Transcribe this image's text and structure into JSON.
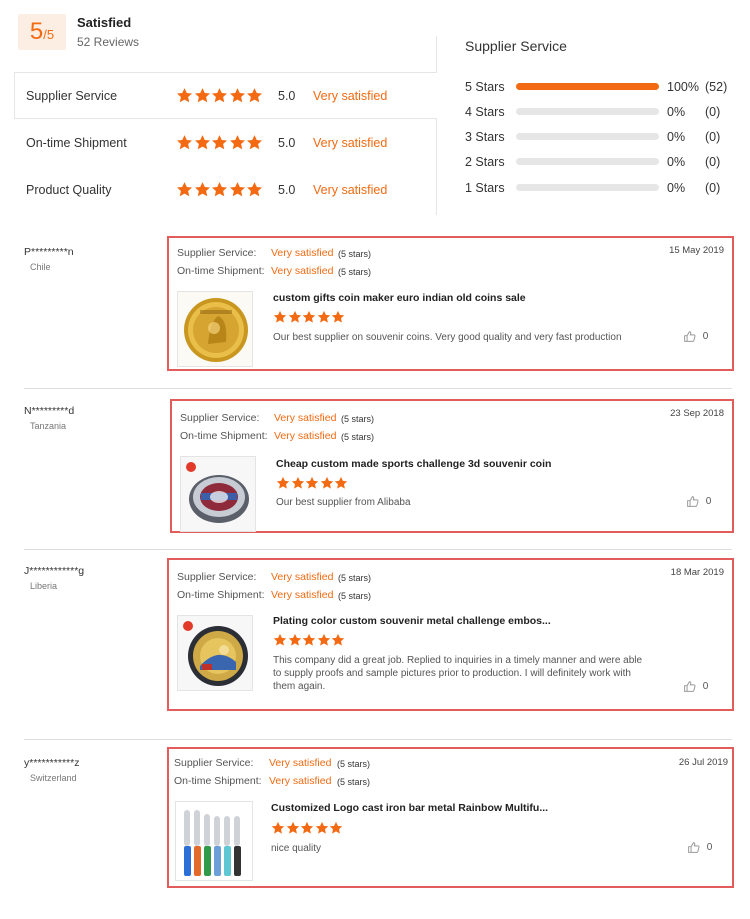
{
  "summary": {
    "score": "5",
    "score_suffix": "/5",
    "title": "Satisfied",
    "review_count": "52 Reviews",
    "metrics": [
      {
        "name": "Supplier Service",
        "score": "5.0",
        "verdict": "Very satisfied",
        "stars": 5
      },
      {
        "name": "On-time Shipment",
        "score": "5.0",
        "verdict": "Very satisfied",
        "stars": 5
      },
      {
        "name": "Product Quality",
        "score": "5.0",
        "verdict": "Very satisfied",
        "stars": 5
      }
    ]
  },
  "distribution": {
    "title": "Supplier Service",
    "rows": [
      {
        "label": "5 Stars",
        "fraction": 1.0,
        "pct": "100%",
        "count": "(52)"
      },
      {
        "label": "4 Stars",
        "fraction": 0.0,
        "pct": "0%",
        "count": "(0)"
      },
      {
        "label": "3 Stars",
        "fraction": 0.0,
        "pct": "0%",
        "count": "(0)"
      },
      {
        "label": "2 Stars",
        "fraction": 0.0,
        "pct": "0%",
        "count": "(0)"
      },
      {
        "label": "1 Stars",
        "fraction": 0.0,
        "pct": "0%",
        "count": "(0)"
      }
    ]
  },
  "reviews": [
    {
      "reviewer": "P*********n",
      "country": "Chile",
      "service_label": "Supplier Service:",
      "service_verdict": "Very satisfied",
      "service_stars": "(5 stars)",
      "shipment_label": "On-time Shipment:",
      "shipment_verdict": "Very satisfied",
      "shipment_stars": "(5 stars)",
      "date": "15 May 2019",
      "product_title": "custom gifts coin maker euro indian old coins sale",
      "rating": 5,
      "comment": "Our best supplier on souvenir coins. Very good quality and very fast production",
      "likes": "0",
      "thumb": "gold-coin-image"
    },
    {
      "reviewer": "N*********d",
      "country": "Tanzania",
      "service_label": "Supplier Service:",
      "service_verdict": "Very satisfied",
      "service_stars": "(5 stars)",
      "shipment_label": "On-time Shipment:",
      "shipment_verdict": "Very satisfied",
      "shipment_stars": "(5 stars)",
      "date": "23 Sep 2018",
      "product_title": "Cheap custom made sports challenge 3d souvenir coin",
      "rating": 5,
      "comment": "Our best supplier from Alibaba",
      "likes": "0",
      "thumb": "challenge-coin-image"
    },
    {
      "reviewer": "J************g",
      "country": "Liberia",
      "service_label": "Supplier Service:",
      "service_verdict": "Very satisfied",
      "service_stars": "(5 stars)",
      "shipment_label": "On-time Shipment:",
      "shipment_verdict": "Very satisfied",
      "shipment_stars": "(5 stars)",
      "date": "18 Mar 2019",
      "product_title": "Plating color custom souvenir metal challenge embos...",
      "rating": 5,
      "comment": "This company did a great job.  Replied to inquiries in a timely manner and were able to supply proofs and sample pictures prior to production. I will definitely work with them again.",
      "likes": "0",
      "thumb": "enamel-coin-image"
    },
    {
      "reviewer": "y***********z",
      "country": "Switzerland",
      "service_label": "Supplier Service:",
      "service_verdict": "Very satisfied",
      "service_stars": "(5 stars)",
      "shipment_label": "On-time Shipment:",
      "shipment_verdict": "Very satisfied",
      "shipment_stars": "(5 stars)",
      "date": "26 Jul 2019",
      "product_title": "Customized Logo cast iron bar metal Rainbow Multifu...",
      "rating": 5,
      "comment": "nice quality",
      "likes": "0",
      "thumb": "bottle-opener-image"
    }
  ],
  "colors": {
    "accent": "#f36a12",
    "card_border": "#e25c5c",
    "badge_bg": "#fdeee3"
  }
}
